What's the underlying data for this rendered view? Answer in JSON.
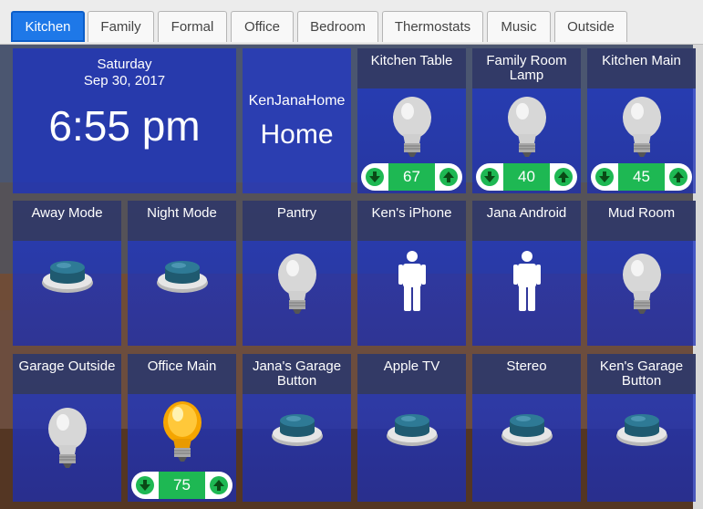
{
  "tabs": [
    {
      "label": "Kitchen",
      "active": true
    },
    {
      "label": "Family"
    },
    {
      "label": "Formal"
    },
    {
      "label": "Office"
    },
    {
      "label": "Bedroom"
    },
    {
      "label": "Thermostats"
    },
    {
      "label": "Music"
    },
    {
      "label": "Outside"
    }
  ],
  "clock": {
    "day": "Saturday",
    "date": "Sep 30, 2017",
    "time": "6:55 pm"
  },
  "mode": {
    "name": "KenJanaHome",
    "value": "Home"
  },
  "tiles": {
    "kitchen_table": {
      "label": "Kitchen Table",
      "icon": "bulb-off-icon",
      "level": "67"
    },
    "family_room_lamp": {
      "label": "Family Room Lamp",
      "icon": "bulb-off-icon",
      "level": "40"
    },
    "kitchen_main": {
      "label": "Kitchen Main",
      "icon": "bulb-off-icon",
      "level": "45"
    },
    "away_mode": {
      "label": "Away Mode",
      "icon": "push-button-icon"
    },
    "night_mode": {
      "label": "Night Mode",
      "icon": "push-button-icon"
    },
    "pantry": {
      "label": "Pantry",
      "icon": "bulb-off-icon"
    },
    "kens_iphone": {
      "label": "Ken's iPhone",
      "icon": "person-present-icon"
    },
    "jana_android": {
      "label": "Jana Android",
      "icon": "person-present-icon"
    },
    "mud_room": {
      "label": "Mud Room",
      "icon": "bulb-off-icon"
    },
    "garage_outside": {
      "label": "Garage Outside",
      "icon": "bulb-off-icon"
    },
    "office_main": {
      "label": "Office Main",
      "icon": "bulb-on-icon",
      "level": "75"
    },
    "janas_garage_button": {
      "label": "Jana's Garage Button",
      "icon": "push-button-icon"
    },
    "apple_tv": {
      "label": "Apple TV",
      "icon": "push-button-icon"
    },
    "stereo": {
      "label": "Stereo",
      "icon": "push-button-icon"
    },
    "kens_garage_button": {
      "label": "Ken's Garage Button",
      "icon": "push-button-icon"
    }
  },
  "colors": {
    "tab_active": "#1e78e8",
    "tile_bg": "#1e38c8",
    "tile_header": "#343a5c",
    "level_bg": "#1eb853",
    "arrow": "#1eb853"
  }
}
